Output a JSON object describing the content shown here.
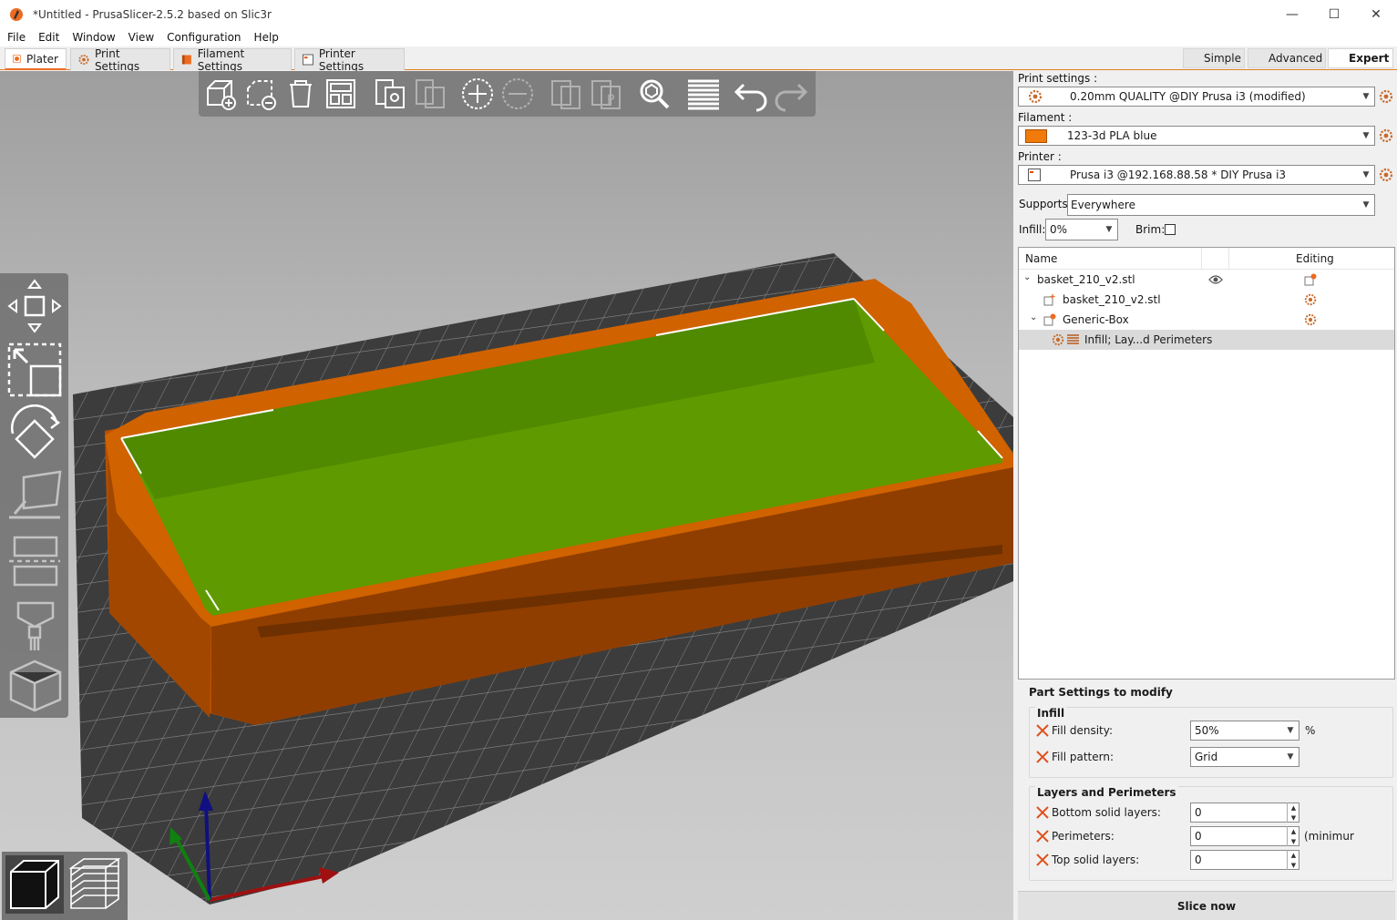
{
  "window": {
    "title": "*Untitled - PrusaSlicer-2.5.2 based on Slic3r",
    "controls": [
      "—",
      "☐",
      "✕"
    ]
  },
  "menu": [
    "File",
    "Edit",
    "Window",
    "View",
    "Configuration",
    "Help"
  ],
  "tabs": [
    {
      "label": "Plater",
      "icon": "plater-icon"
    },
    {
      "label": "Print Settings",
      "icon": "gear-icon"
    },
    {
      "label": "Filament Settings",
      "icon": "spool-icon"
    },
    {
      "label": "Printer Settings",
      "icon": "printer-icon"
    }
  ],
  "modes": [
    {
      "label": "Simple",
      "color": "#3cc43c"
    },
    {
      "label": "Advanced",
      "color": "#f5d316"
    },
    {
      "label": "Expert",
      "color": "#e01414"
    }
  ],
  "sidebar": {
    "print_settings_label": "Print settings :",
    "print_settings_value": "0.20mm QUALITY @DIY Prusa i3 (modified)",
    "filament_label": "Filament :",
    "filament_value": "123-3d PLA blue",
    "filament_color": "#f07a0a",
    "printer_label": "Printer :",
    "printer_value": "Prusa i3 @192.168.88.58 * DIY Prusa i3",
    "supports_label": "Supports:",
    "supports_value": "Everywhere",
    "infill_label": "Infill:",
    "infill_value": "0%",
    "brim_label": "Brim:"
  },
  "object_list": {
    "col_name": "Name",
    "col_editing": "Editing",
    "rows": [
      {
        "label": "basket_210_v2.stl"
      },
      {
        "label": "basket_210_v2.stl"
      },
      {
        "label": "Generic-Box"
      },
      {
        "label": "Infill; Lay...d Perimeters"
      }
    ]
  },
  "part_settings": {
    "title": "Part Settings to modify",
    "infill_group": "Infill",
    "fill_density_label": "Fill density:",
    "fill_density_value": "50%",
    "fill_density_unit": "%",
    "fill_pattern_label": "Fill pattern:",
    "fill_pattern_value": "Grid",
    "layers_group": "Layers and Perimeters",
    "bottom_label": "Bottom solid layers:",
    "bottom_value": "0",
    "perimeters_label": "Perimeters:",
    "perimeters_value": "0",
    "perimeters_unit": "(minimur",
    "top_label": "Top solid layers:",
    "top_value": "0"
  },
  "slice_button": "Slice now",
  "colors": {
    "accent": "#ed6b21",
    "model_orange": "#c85a00",
    "modifier_green": "#5f9a00"
  }
}
